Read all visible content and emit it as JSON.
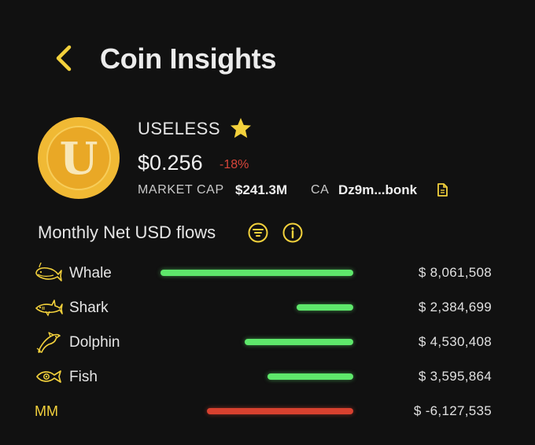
{
  "header": {
    "title": "Coin Insights",
    "back_icon": "chevron-left-icon"
  },
  "coin": {
    "logo_letter": "U",
    "name": "USELESS",
    "favorite": true,
    "price": "$0.256",
    "change": "-18%",
    "market_cap_label": "MARKET CAP",
    "market_cap_value": "$241.3M",
    "ca_label": "CA",
    "ca_value": "Dz9m...bonk"
  },
  "flows": {
    "title": "Monthly Net USD flows",
    "rows": [
      {
        "label": "Whale",
        "icon": "whale-icon",
        "value": "$ 8,061,508",
        "amount": 8061508
      },
      {
        "label": "Shark",
        "icon": "shark-icon",
        "value": "$ 2,384,699",
        "amount": 2384699
      },
      {
        "label": "Dolphin",
        "icon": "dolphin-icon",
        "value": "$ 4,530,408",
        "amount": 4530408
      },
      {
        "label": "Fish",
        "icon": "fish-icon",
        "value": "$ 3,595,864",
        "amount": 3595864
      },
      {
        "label": "MM",
        "icon": "",
        "value": "$ -6,127,535",
        "amount": -6127535
      }
    ]
  },
  "colors": {
    "accent": "#f3d13c",
    "positive": "#5ee86b",
    "negative": "#d8412f",
    "background": "#111111"
  }
}
